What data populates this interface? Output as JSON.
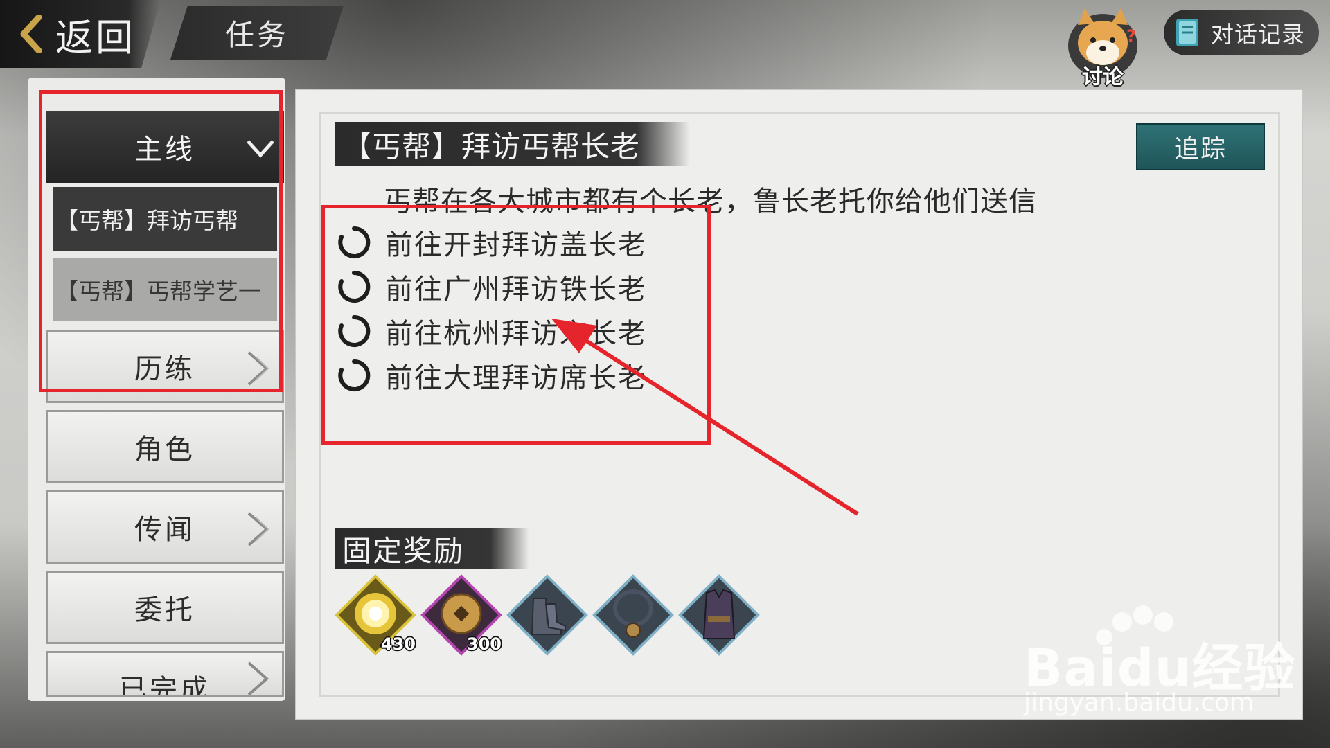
{
  "header": {
    "back_label": "返回",
    "title": "任务",
    "discuss_label": "讨论",
    "dialog_log_label": "对话记录"
  },
  "nav": {
    "main_label": "主线",
    "sub_items": [
      {
        "label": "【丐帮】拜访丐帮"
      },
      {
        "label": "【丐帮】丐帮学艺一"
      }
    ],
    "categories": [
      {
        "label": "历练"
      },
      {
        "label": "角色"
      },
      {
        "label": "传闻"
      },
      {
        "label": "委托"
      },
      {
        "label": "已完成"
      }
    ]
  },
  "quest": {
    "title": "【丐帮】拜访丐帮长老",
    "track_label": "追踪",
    "description": "丐帮在各大城市都有个长老，鲁长老托你给他们送信",
    "objectives": [
      "前往开封拜访盖长老",
      "前往广州拜访铁长老",
      "前往杭州拜访宋长老",
      "前往大理拜访席长老"
    ]
  },
  "rewards": {
    "title": "固定奖励",
    "items": [
      {
        "icon": "experience-orb-icon",
        "count": "430"
      },
      {
        "icon": "coin-icon",
        "count": "300"
      },
      {
        "icon": "boots-icon",
        "count": ""
      },
      {
        "icon": "necklace-icon",
        "count": ""
      },
      {
        "icon": "armor-vest-icon",
        "count": ""
      }
    ]
  },
  "watermark": {
    "brand": "Baidu经验",
    "url": "jingyan.baidu.com"
  },
  "colors": {
    "annotation_red": "#e5252b",
    "track_teal": "#2f7276"
  }
}
